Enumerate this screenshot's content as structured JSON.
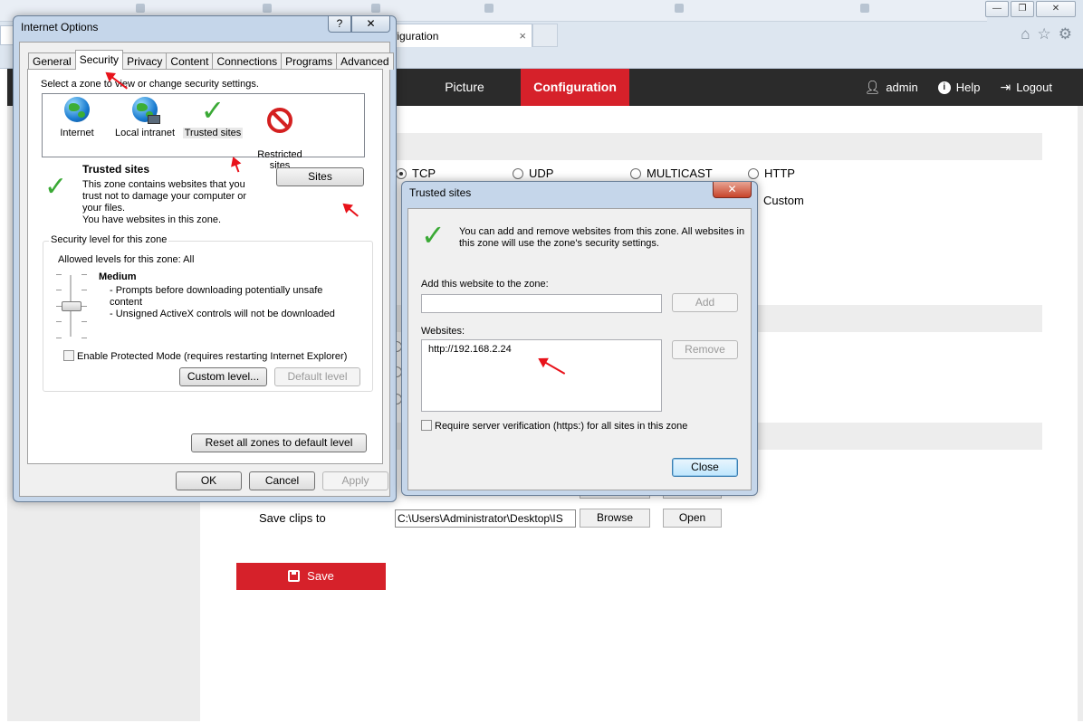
{
  "browser": {
    "active_tab_title": "figuration",
    "tab_close": "×",
    "window_buttons": {
      "minimize": "—",
      "maximize": "❐",
      "close": "✕"
    }
  },
  "app": {
    "nav": {
      "picture": "Picture",
      "configuration": "Configuration"
    },
    "user": {
      "admin": "admin",
      "help": "Help",
      "logout": "Logout"
    },
    "protocols": [
      {
        "label": "TCP",
        "checked": true
      },
      {
        "label": "UDP",
        "checked": false
      },
      {
        "label": "MULTICAST",
        "checked": false
      },
      {
        "label": "HTTP",
        "checked": false
      }
    ],
    "custom_label": "Custom",
    "save_clips_label": "Save clips to",
    "save_clips_path": "C:\\Users\\Administrator\\Desktop\\IS",
    "browse_label": "Browse",
    "open_label": "Open",
    "save_label": "Save",
    "accent_color": "#d6212a"
  },
  "internet_options": {
    "title": "Internet Options",
    "help_btn": "?",
    "close_btn": "✕",
    "tabs": [
      "General",
      "Security",
      "Privacy",
      "Content",
      "Connections",
      "Programs",
      "Advanced"
    ],
    "selected_tab": "Security",
    "zone_prompt": "Select a zone to view or change security settings.",
    "zones": [
      {
        "label": "Internet",
        "icon": "globe-icon"
      },
      {
        "label": "Local intranet",
        "icon": "intranet-icon"
      },
      {
        "label": "Trusted sites",
        "icon": "checkmark-icon"
      },
      {
        "label": "Restricted\nsites",
        "icon": "restricted-icon"
      }
    ],
    "zone_title": "Trusted sites",
    "zone_desc_1": "This zone contains websites that you\ntrust not to damage your computer or\nyour files.",
    "zone_desc_2": "You have websites in this zone.",
    "sites_btn": "Sites",
    "security_group_title": "Security level for this zone",
    "allowed_levels": "Allowed levels for this zone: All",
    "level_name": "Medium",
    "level_desc_1": "- Prompts before downloading potentially unsafe\ncontent",
    "level_desc_2": "- Unsigned ActiveX controls will not be downloaded",
    "protected_mode": "Enable Protected Mode (requires restarting Internet Explorer)",
    "custom_level_btn": "Custom level...",
    "default_level_btn": "Default level",
    "reset_all_btn": "Reset all zones to default level",
    "ok_btn": "OK",
    "cancel_btn": "Cancel",
    "apply_btn": "Apply"
  },
  "trusted_sites": {
    "title": "Trusted sites",
    "close_btn": "✕",
    "info": "You can add and remove websites from this zone. All websites in this zone will use the zone's security settings.",
    "add_label": "Add this website to the zone:",
    "add_value": "",
    "add_btn": "Add",
    "websites_label": "Websites:",
    "websites": [
      "http://192.168.2.24"
    ],
    "remove_btn": "Remove",
    "require_https": "Require server verification (https:) for all sites in this zone",
    "close_dialog_btn": "Close"
  },
  "annotation_color": "#e8121a"
}
